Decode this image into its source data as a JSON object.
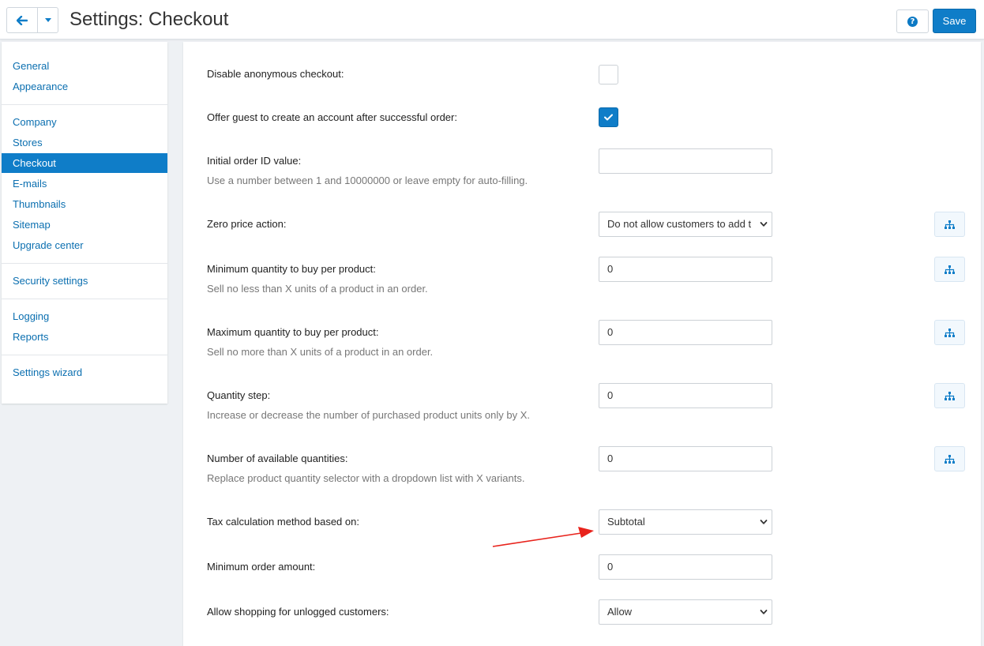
{
  "header": {
    "title": "Settings: Checkout",
    "save_label": "Save",
    "help_glyph": "?"
  },
  "sidebar": {
    "items": [
      {
        "label": "General",
        "active": false
      },
      {
        "label": "Appearance",
        "active": false
      },
      {
        "label": "Company",
        "active": false
      },
      {
        "label": "Stores",
        "active": false
      },
      {
        "label": "Checkout",
        "active": true
      },
      {
        "label": "E-mails",
        "active": false
      },
      {
        "label": "Thumbnails",
        "active": false
      },
      {
        "label": "Sitemap",
        "active": false
      },
      {
        "label": "Upgrade center",
        "active": false
      },
      {
        "label": "Security settings",
        "active": false
      },
      {
        "label": "Logging",
        "active": false
      },
      {
        "label": "Reports",
        "active": false
      },
      {
        "label": "Settings wizard",
        "active": false
      }
    ]
  },
  "settings": {
    "disable_anon": {
      "label": "Disable anonymous checkout:",
      "checked": false
    },
    "offer_guest": {
      "label": "Offer guest to create an account after successful order:",
      "checked": true
    },
    "initial_order_id": {
      "label": "Initial order ID value:",
      "desc": "Use a number between 1 and 10000000 or leave empty for auto-filling.",
      "value": ""
    },
    "zero_price": {
      "label": "Zero price action:",
      "value": "Do not allow customers to add t"
    },
    "min_qty": {
      "label": "Minimum quantity to buy per product:",
      "desc": "Sell no less than X units of a product in an order.",
      "value": "0"
    },
    "max_qty": {
      "label": "Maximum quantity to buy per product:",
      "desc": "Sell no more than X units of a product in an order.",
      "value": "0"
    },
    "qty_step": {
      "label": "Quantity step:",
      "desc": "Increase or decrease the number of purchased product units only by X.",
      "value": "0"
    },
    "avail_qty": {
      "label": "Number of available quantities:",
      "desc": "Replace product quantity selector with a dropdown list with X variants.",
      "value": "0"
    },
    "tax_method": {
      "label": "Tax calculation method based on:",
      "value": "Subtotal"
    },
    "min_order": {
      "label": "Minimum order amount:",
      "value": "0"
    },
    "allow_unlogged": {
      "label": "Allow shopping for unlogged customers:",
      "value": "Allow"
    }
  },
  "colors": {
    "accent": "#0f7dc8",
    "link": "#0b6fb0",
    "annotation_arrow": "#e8231c"
  },
  "icons": {
    "back": "arrow-left-icon",
    "caret": "caret-down-icon",
    "help": "question-circle-icon",
    "tree": "sitemap-icon",
    "check": "check-icon"
  }
}
